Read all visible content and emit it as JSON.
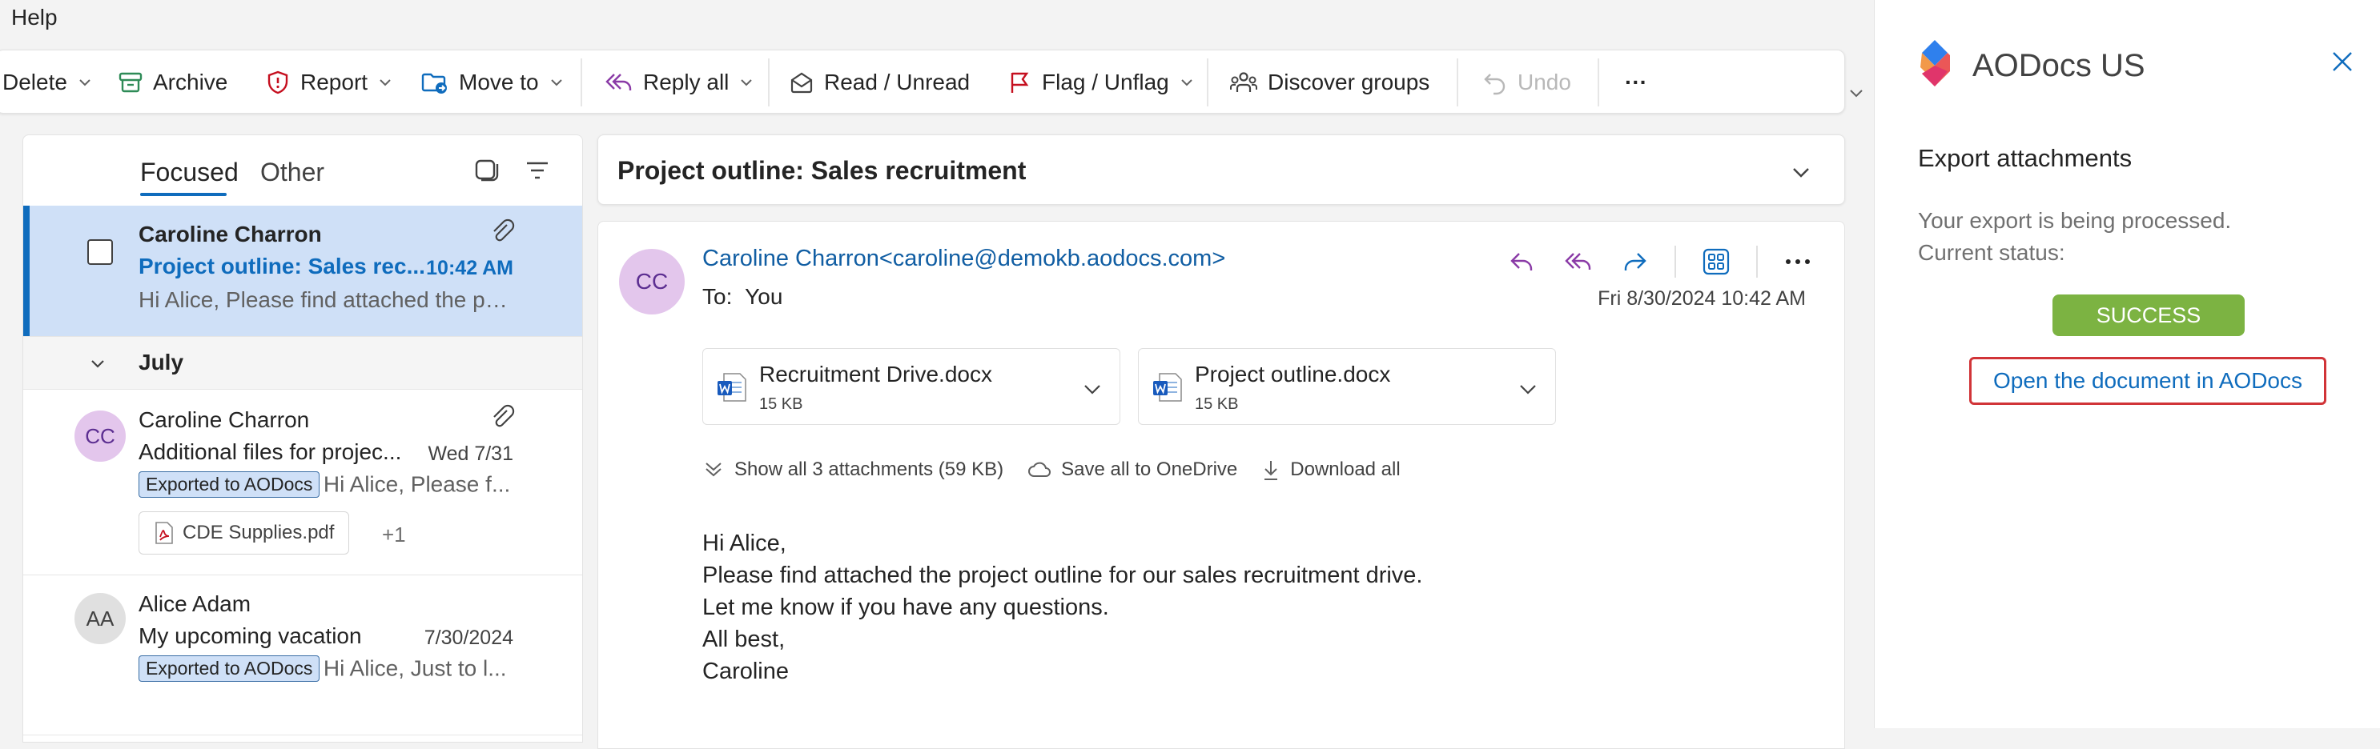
{
  "menubar": {
    "help": "Help"
  },
  "toolbar": {
    "delete": "Delete",
    "archive": "Archive",
    "report": "Report",
    "move_to": "Move to",
    "reply_all": "Reply all",
    "read_unread": "Read / Unread",
    "flag_unflag": "Flag / Unflag",
    "discover_groups": "Discover groups",
    "undo": "Undo",
    "more": "···"
  },
  "list": {
    "tabs": {
      "focused": "Focused",
      "other": "Other"
    },
    "items": [
      {
        "sender": "Caroline Charron",
        "subject": "Project outline: Sales rec...",
        "time": "10:42 AM",
        "preview": "Hi Alice, Please find attached the pr..."
      },
      {
        "initials": "CC",
        "sender": "Caroline Charron",
        "subject": "Additional files for projec...",
        "time": "Wed 7/31",
        "badge": "Exported to AODocs",
        "preview": "Hi Alice, Please f...",
        "attachment": "CDE Supplies.pdf",
        "more": "+1"
      },
      {
        "initials": "AA",
        "sender": "Alice Adam",
        "subject": "My upcoming vacation",
        "time": "7/30/2024",
        "badge": "Exported to AODocs",
        "preview": "Hi Alice, Just to l..."
      }
    ],
    "group_label": "July"
  },
  "reading": {
    "subject": "Project outline: Sales recruitment",
    "avatar": "CC",
    "from": "Caroline Charron<caroline@demokb.aodocs.com>",
    "to_label": "To:",
    "to": "You",
    "date": "Fri 8/30/2024 10:42 AM",
    "attachments": [
      {
        "name": "Recruitment Drive.docx",
        "size": "15 KB"
      },
      {
        "name": "Project outline.docx",
        "size": "15 KB"
      }
    ],
    "show_all": "Show all 3 attachments (59 KB)",
    "save_all": "Save all to OneDrive",
    "download_all": "Download all",
    "body": [
      "Hi Alice,",
      "Please find attached the project outline for our sales recruitment drive.",
      "Let me know if you have any questions.",
      "All best,",
      "Caroline"
    ]
  },
  "addin": {
    "brand": "AODocs US",
    "heading": "Export attachments",
    "status_line1": "Your export is being processed.",
    "status_line2": "Current status:",
    "success": "SUCCESS",
    "open_link": "Open the document in AODocs"
  },
  "colors": {
    "accent": "#0f6cbd",
    "selected_bg": "#cfe0f7",
    "success": "#7cb342",
    "highlight_border": "#d13438",
    "reply_purple": "#8a3aa6"
  },
  "icons": [
    "chevron-down-icon",
    "archive-icon",
    "shield-icon",
    "folder-move-icon",
    "reply-all-icon",
    "envelope-open-icon",
    "flag-icon",
    "people-icon",
    "undo-icon",
    "more-icon",
    "compose-icon",
    "filter-icon",
    "paperclip-icon",
    "pdf-icon",
    "word-icon",
    "reply-icon",
    "forward-icon",
    "apps-icon",
    "cloud-icon",
    "download-icon",
    "close-icon",
    "aodocs-logo-icon"
  ]
}
